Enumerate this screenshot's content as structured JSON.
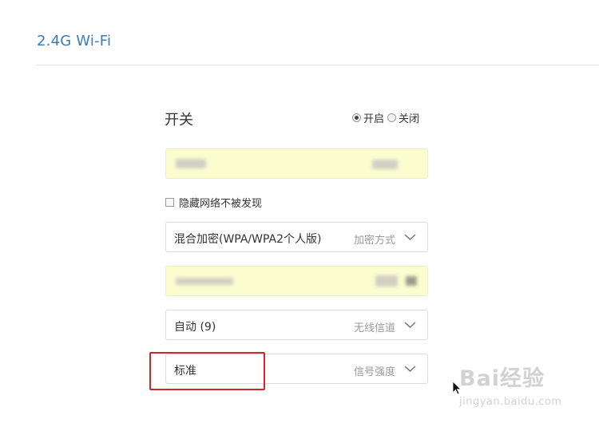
{
  "header": {
    "title": "2.4G Wi-Fi"
  },
  "switch": {
    "label": "开关",
    "options": [
      {
        "label": "开启",
        "checked": true
      },
      {
        "label": "关闭",
        "checked": false
      }
    ]
  },
  "ssid_field": {
    "value_redacted": true
  },
  "hide_network": {
    "label": "隐藏网络不被发现",
    "checked": false
  },
  "encryption": {
    "value": "混合加密(WPA/WPA2个人版)",
    "hint": "加密方式",
    "icon": "chevron-down-icon"
  },
  "password_field": {
    "value_redacted": true
  },
  "channel": {
    "value": "自动 (9)",
    "hint": "无线信道",
    "icon": "chevron-down-icon"
  },
  "signal": {
    "value": "标准",
    "hint": "信号强度",
    "icon": "chevron-down-icon"
  },
  "watermark": {
    "brand": "Bai经验",
    "url": "jingyan.baidu.com"
  },
  "colors": {
    "title": "#3a7bbf",
    "autofill_bg": "#fbfdcf",
    "highlight": "#cc2a2a"
  }
}
